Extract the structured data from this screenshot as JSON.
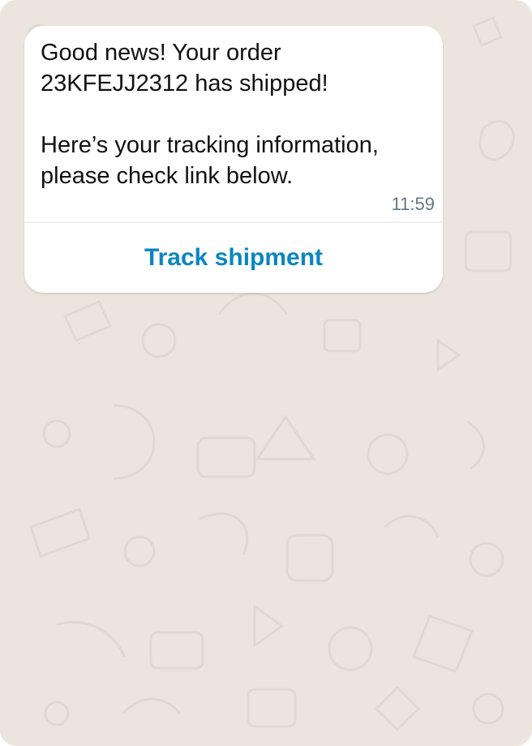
{
  "message": {
    "text": "Good news! Your order\n23KFEJJ2312 has shipped!\n\nHere’s your tracking information,\nplease check link below.",
    "time": "11:59",
    "action_label": "Track shipment"
  },
  "colors": {
    "chat_background": "#ece5dd",
    "bubble_background": "#ffffff",
    "action_text": "#0a86c1",
    "timestamp_text": "#667781"
  },
  "icons": {
    "background_pattern": "wallpaper-doodle-icon"
  }
}
